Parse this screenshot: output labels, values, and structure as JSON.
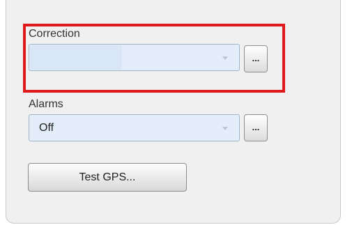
{
  "correction": {
    "label": "Correction",
    "value": "",
    "browse_label": "..."
  },
  "alarms": {
    "label": "Alarms",
    "value": "Off",
    "browse_label": "..."
  },
  "test_gps": {
    "label": "Test GPS..."
  },
  "colors": {
    "highlight": "#e01a1a",
    "combo_fill": "#e4eefa"
  }
}
